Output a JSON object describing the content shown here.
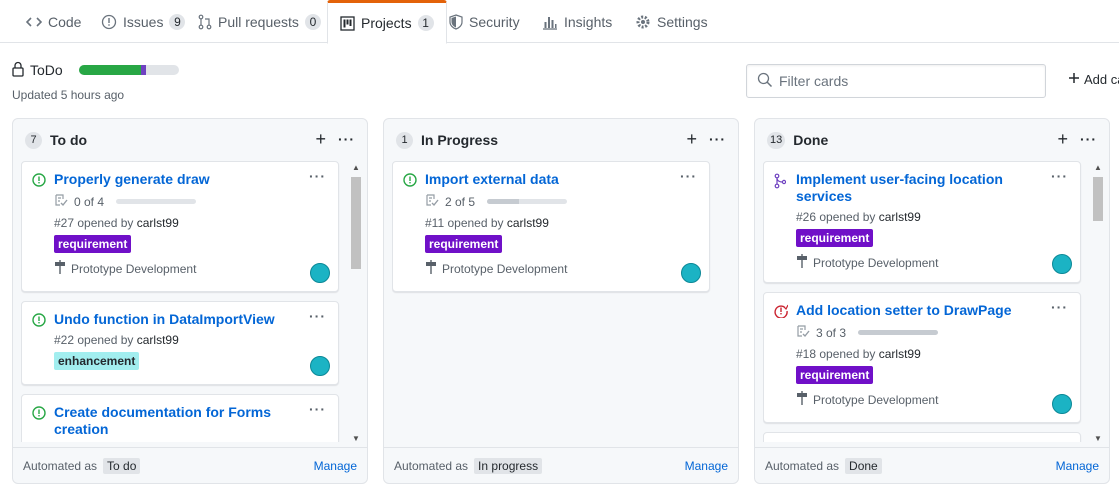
{
  "tabs": [
    {
      "label": "Code",
      "count": ""
    },
    {
      "label": "Issues",
      "count": "9"
    },
    {
      "label": "Pull requests",
      "count": "0"
    },
    {
      "label": "Projects",
      "count": "1"
    },
    {
      "label": "Security",
      "count": ""
    },
    {
      "label": "Insights",
      "count": ""
    },
    {
      "label": "Settings",
      "count": ""
    }
  ],
  "project": {
    "title": "ToDo",
    "updated": "Updated 5 hours ago",
    "progress": {
      "done_fraction": 0.62,
      "in_progress_fraction": 0.05
    },
    "filter_placeholder": "Filter cards",
    "add_cards_label": "Add ca"
  },
  "colors": {
    "done": "#28a745",
    "in_progress": "#6f42c1",
    "requirement": "#7010c8",
    "enhancement": "#a2eeef",
    "link": "#0366d6",
    "open_icon": "#28a745",
    "closed_icon": "#cb2431",
    "merged_icon": "#6f42c1"
  },
  "columns": [
    {
      "name": "To do",
      "count": "7",
      "automated_prefix": "Automated as",
      "automated_label": "To do",
      "manage_label": "Manage",
      "cards": [
        {
          "title": "Properly generate draw",
          "tasks": "0 of 4",
          "task_fraction": 0,
          "meta_prefix": "#27 opened by",
          "author": "carlst99",
          "label": "requirement",
          "milestone": "Prototype Development"
        },
        {
          "title": "Undo function in DataImportView",
          "meta_prefix": "#22 opened by",
          "author": "carlst99",
          "label": "enhancement"
        },
        {
          "title": "Create documentation for Forms creation"
        }
      ]
    },
    {
      "name": "In Progress",
      "count": "1",
      "automated_prefix": "Automated as",
      "automated_label": "In progress",
      "manage_label": "Manage",
      "cards": [
        {
          "title": "Import external data",
          "tasks": "2 of 5",
          "task_fraction": 0.4,
          "meta_prefix": "#11 opened by",
          "author": "carlst99",
          "label": "requirement",
          "milestone": "Prototype Development"
        }
      ]
    },
    {
      "name": "Done",
      "count": "13",
      "automated_prefix": "Automated as",
      "automated_label": "Done",
      "manage_label": "Manage",
      "cards": [
        {
          "title": "Implement user-facing location services",
          "meta_prefix": "#26 opened by",
          "author": "carlst99",
          "label": "requirement",
          "milestone": "Prototype Development"
        },
        {
          "title": "Add location setter to DrawPage",
          "tasks": "3 of 3",
          "task_fraction": 1,
          "meta_prefix": "#18 opened by",
          "author": "carlst99",
          "label": "requirement",
          "milestone": "Prototype Development"
        }
      ]
    }
  ]
}
